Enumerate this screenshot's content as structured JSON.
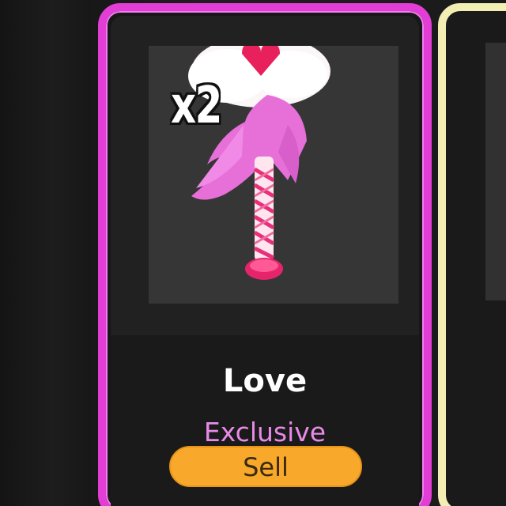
{
  "item_card": {
    "quantity": "x2",
    "name": "Love",
    "rarity": "Exclusive",
    "sell_label": "Sell",
    "border_color": "#e23ed6",
    "rarity_color": "#e88ae8",
    "button_color": "#f8a82a",
    "item_icon": "pink-feathered-love-wand"
  },
  "next_card": {
    "border_color": "#f3eeb4"
  }
}
